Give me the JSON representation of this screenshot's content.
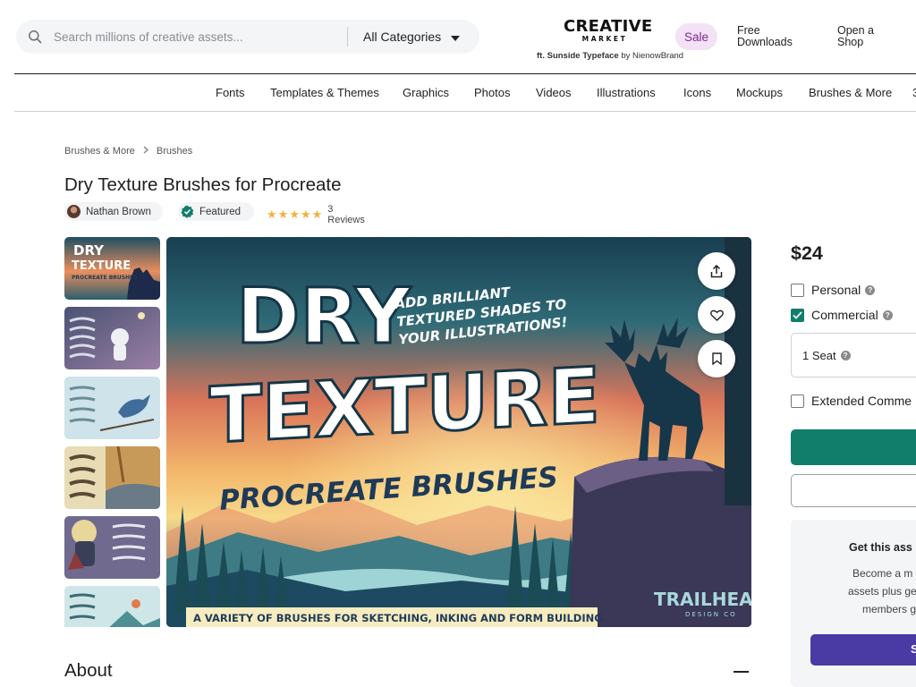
{
  "header": {
    "search_placeholder": "Search millions of creative assets...",
    "category_select": "All Categories",
    "logo_main": "CREATIVE",
    "logo_sub": "MARKET",
    "logo_credit_prefix": "ft. Sunside Typeface",
    "logo_credit_by": "by",
    "logo_credit_author": "NienowBrand",
    "sale_label": "Sale",
    "free_downloads_label": "Free Downloads",
    "open_shop_label": "Open a Shop"
  },
  "categories": [
    "Fonts",
    "Templates & Themes",
    "Graphics",
    "Photos",
    "Videos",
    "Illustrations",
    "Icons",
    "Mockups",
    "Brushes & More",
    "3"
  ],
  "breadcrumb": [
    "Brushes & More",
    "Brushes"
  ],
  "product": {
    "title": "Dry Texture Brushes for Procreate",
    "author": "Nathan Brown",
    "featured_label": "Featured",
    "rating": 5,
    "reviews_label": "3 Reviews"
  },
  "hero": {
    "title_line1": "DRY",
    "title_line2": "TEXTURE",
    "subtitle": "PROCREATE BRUSHES",
    "tagline_line1": "ADD BRILLIANT",
    "tagline_line2": "TEXTURED SHADES TO",
    "tagline_line3": "YOUR ILLUSTRATIONS!",
    "brand": "TRAILHEAD",
    "brand_sub": "DESIGN CO",
    "banner": "A VARIETY OF BRUSHES FOR SKETCHING, INKING AND FORM BUILDING"
  },
  "thumbnails": {
    "first_line1": "DRY",
    "first_line2": "TEXTURE",
    "first_line3": "PROCREATE BRUSHES"
  },
  "about": {
    "title": "About"
  },
  "pricing": {
    "price": "$24",
    "licenses": [
      {
        "label": "Personal",
        "checked": false
      },
      {
        "label": "Commercial",
        "checked": true
      },
      {
        "label": "Extended Comme",
        "checked": false
      }
    ],
    "seat_label": "1 Seat"
  },
  "promo": {
    "title": "Get this ass",
    "line1": "Become a m",
    "line2": "assets plus ge",
    "line3": "members g",
    "button_label": "S"
  },
  "colors": {
    "accent_green": "#117e6b",
    "sale_bg": "#f3e1f5",
    "sale_text": "#7b2b8c",
    "promo_button": "#4a3aa3",
    "star": "#f2b33d"
  }
}
